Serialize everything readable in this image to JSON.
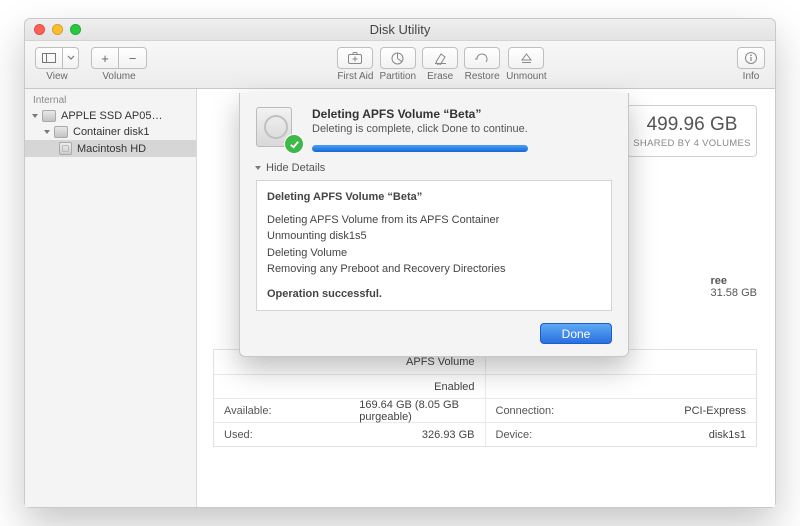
{
  "window": {
    "title": "Disk Utility"
  },
  "toolbar": {
    "view_label": "View",
    "volume_label": "Volume",
    "info_label": "Info",
    "tools": [
      {
        "label": "First Aid",
        "name": "firstaid"
      },
      {
        "label": "Partition",
        "name": "partition"
      },
      {
        "label": "Erase",
        "name": "erase"
      },
      {
        "label": "Restore",
        "name": "restore"
      },
      {
        "label": "Unmount",
        "name": "unmount"
      }
    ]
  },
  "sidebar": {
    "header": "Internal",
    "items": [
      {
        "label": "APPLE SSD AP05…",
        "level": 0
      },
      {
        "label": "Container disk1",
        "level": 1
      },
      {
        "label": "Macintosh HD",
        "level": 2,
        "selected": true
      }
    ]
  },
  "capacity": {
    "value": "499.96 GB",
    "sub": "SHARED BY 4 VOLUMES"
  },
  "free": {
    "heading": "ree",
    "value": "31.58 GB"
  },
  "info_rows": [
    {
      "l1": "",
      "v1": "APFS Volume",
      "l2": "",
      "v2": ""
    },
    {
      "l1": "",
      "v1": "Enabled",
      "l2": "",
      "v2": ""
    },
    {
      "l1": "Available:",
      "v1": "169.64 GB (8.05 GB purgeable)",
      "l2": "Connection:",
      "v2": "PCI-Express"
    },
    {
      "l1": "Used:",
      "v1": "326.93 GB",
      "l2": "Device:",
      "v2": "disk1s1"
    }
  ],
  "dialog": {
    "title": "Deleting APFS Volume “Beta”",
    "subtitle": "Deleting is complete, click Done to continue.",
    "hide_details": "Hide Details",
    "log_heading": "Deleting APFS Volume “Beta”",
    "log_lines": [
      "Deleting APFS Volume from its APFS Container",
      "Unmounting disk1s5",
      "Deleting Volume",
      "Removing any Preboot and Recovery Directories"
    ],
    "log_success": "Operation successful.",
    "done": "Done",
    "progress_pct": 100
  }
}
